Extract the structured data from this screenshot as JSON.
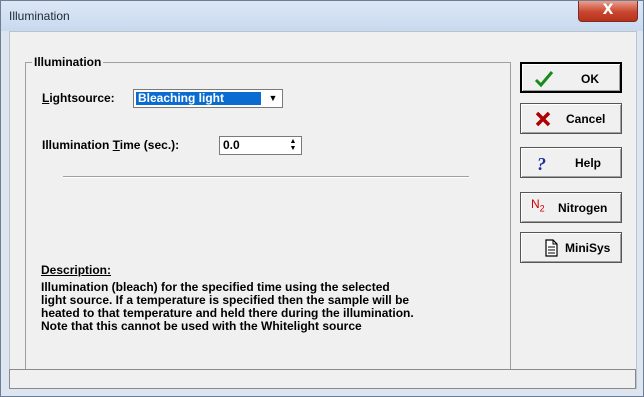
{
  "window": {
    "title": "Illumination",
    "close_label": "X"
  },
  "group": {
    "title": "Illumination"
  },
  "lightsource": {
    "label_pre": "L",
    "label_post": "ightsource:",
    "value": "Bleaching light"
  },
  "illum_time": {
    "label_pre": "Illumination ",
    "label_ul": "T",
    "label_post": "ime (sec.):",
    "value": "0.0"
  },
  "description": {
    "title": "Description:",
    "text": "Illumination (bleach) for the specified time using the selected\nlight source. If a temperature is specified then the sample will be\nheated to that temperature and held there during the illumination.\nNote that this cannot be used with the Whitelight source"
  },
  "buttons": {
    "ok": "OK",
    "cancel": "Cancel",
    "help": "Help",
    "nitrogen": "Nitrogen",
    "minisys": "MiniSys"
  },
  "icons": {
    "ok": "check-icon",
    "cancel": "x-icon",
    "help": "question-icon",
    "nitrogen": "n2-icon",
    "minisys": "document-icon",
    "n2_main": "N",
    "n2_sub": "2",
    "check_color": "#1a8a1a",
    "x_color": "#b00000",
    "question_color": "#1a2e9e",
    "n2_color": "#cc0000"
  },
  "statusbar": {
    "text": ""
  }
}
